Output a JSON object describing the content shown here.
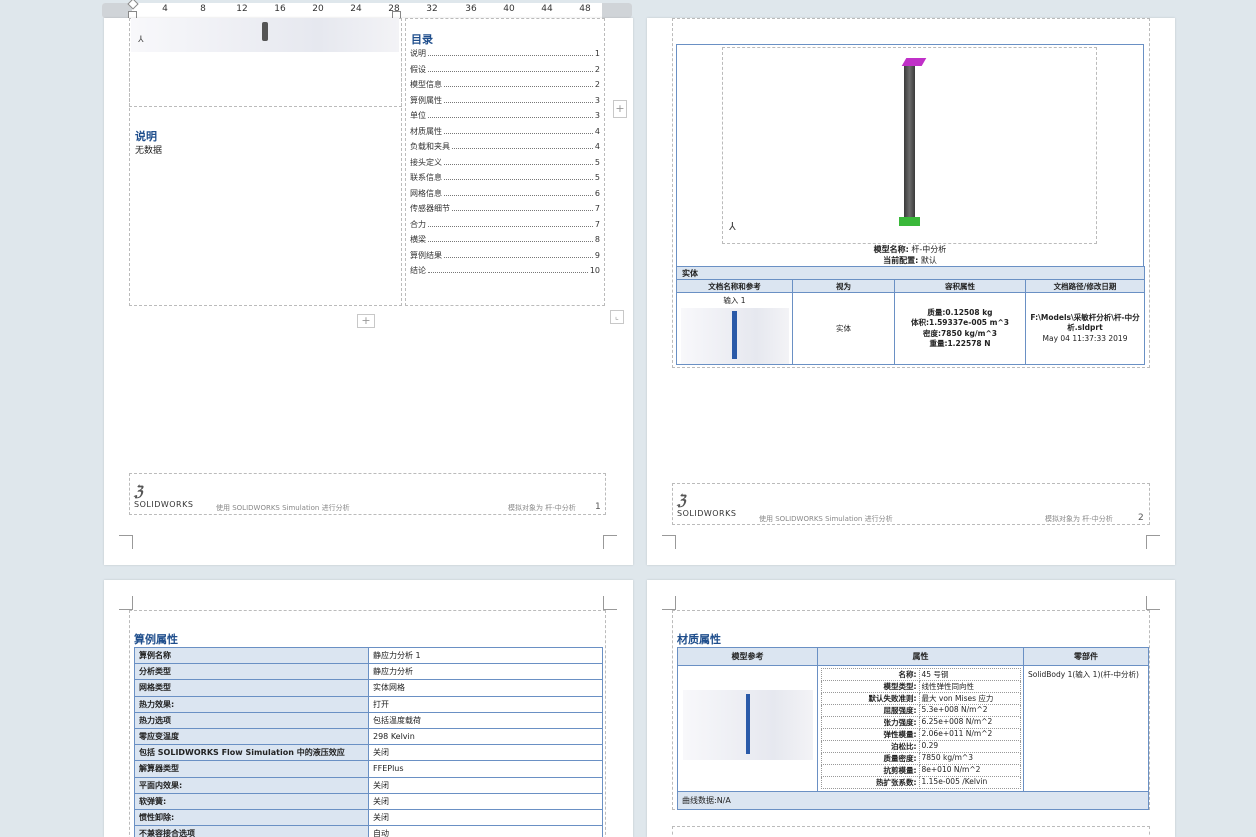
{
  "ruler": {
    "ticks": [
      "4",
      "8",
      "12",
      "16",
      "20",
      "24",
      "28",
      "32",
      "36",
      "40",
      "44",
      "48"
    ]
  },
  "page1": {
    "toc_title": "目录",
    "toc": [
      {
        "label": "说明",
        "page": "1"
      },
      {
        "label": "假设",
        "page": "2"
      },
      {
        "label": "模型信息",
        "page": "2"
      },
      {
        "label": "算例属性",
        "page": "3"
      },
      {
        "label": "单位",
        "page": "3"
      },
      {
        "label": "材质属性",
        "page": "4"
      },
      {
        "label": "负载和夹具",
        "page": "4"
      },
      {
        "label": "接头定义",
        "page": "5"
      },
      {
        "label": "联系信息",
        "page": "5"
      },
      {
        "label": "网格信息",
        "page": "6"
      },
      {
        "label": "传感器细节",
        "page": "7"
      },
      {
        "label": "合力",
        "page": "7"
      },
      {
        "label": "横梁",
        "page": "8"
      },
      {
        "label": "算例结果",
        "page": "9"
      },
      {
        "label": "结论",
        "page": "10"
      }
    ],
    "desc_heading": "说明",
    "desc_text": "无数据",
    "footer_brand": "SOLIDWORKS",
    "footer_text": "使用 SOLIDWORKS Simulation 进行分析",
    "footer_right": "模拟对象为 杆-中分析",
    "page_number": "1"
  },
  "page2": {
    "model_name_label": "模型名称:",
    "model_name": "杆-中分析",
    "config_label": "当前配置:",
    "config": "默认",
    "section": "实体",
    "headers": [
      "文档名称和参考",
      "视为",
      "容积属性",
      "文档路径/修改日期"
    ],
    "row": {
      "ref": "输入 1",
      "treated_as": "实体",
      "mass": "质量:0.12508 kg",
      "volume": "体积:1.59337e-005 m^3",
      "density": "密度:7850 kg/m^3",
      "weight": "重量:1.22578 N",
      "path": "F:\\Models\\采敏杆分析\\杆-中分析.sldprt",
      "date": "May 04 11:37:33 2019"
    },
    "footer_brand": "SOLIDWORKS",
    "footer_text": "使用 SOLIDWORKS Simulation 进行分析",
    "footer_right": "模拟对象为 杆-中分析",
    "page_number": "2"
  },
  "page3": {
    "heading": "算例属性",
    "rows": [
      {
        "k": "算例名称",
        "v": "静应力分析 1"
      },
      {
        "k": "分析类型",
        "v": "静应力分析"
      },
      {
        "k": "网格类型",
        "v": "实体网格"
      },
      {
        "k": "热力效果:",
        "v": "打开"
      },
      {
        "k": "热力选项",
        "v": "包括温度载荷"
      },
      {
        "k": "零应变温度",
        "v": "298 Kelvin"
      },
      {
        "k": "包括 SOLIDWORKS Flow Simulation 中的液压效应",
        "v": "关闭"
      },
      {
        "k": "解算器类型",
        "v": "FFEPlus"
      },
      {
        "k": "平面内效果:",
        "v": "关闭"
      },
      {
        "k": "软弹簧:",
        "v": "关闭"
      },
      {
        "k": "惯性卸除:",
        "v": "关闭"
      },
      {
        "k": "不兼容接合选项",
        "v": "自动"
      }
    ]
  },
  "page4": {
    "heading": "材质属性",
    "headers": [
      "模型参考",
      "属性",
      "零部件"
    ],
    "props": [
      {
        "k": "名称:",
        "v": "45 号钢"
      },
      {
        "k": "模型类型:",
        "v": "线性弹性同向性"
      },
      {
        "k": "默认失败准则:",
        "v": "最大 von Mises 应力"
      },
      {
        "k": "屈服强度:",
        "v": "5.3e+008 N/m^2"
      },
      {
        "k": "张力强度:",
        "v": "6.25e+008 N/m^2"
      },
      {
        "k": "弹性模量:",
        "v": "2.06e+011 N/m^2"
      },
      {
        "k": "泊松比:",
        "v": "0.29"
      },
      {
        "k": "质量密度:",
        "v": "7850 kg/m^3"
      },
      {
        "k": "抗剪模量:",
        "v": "8e+010 N/m^2"
      },
      {
        "k": "热扩张系数:",
        "v": "1.15e-005 /Kelvin"
      }
    ],
    "component": "SolidBody 1(输入 1)(杆-中分析)",
    "curve_data": "曲线数据:N/A"
  }
}
